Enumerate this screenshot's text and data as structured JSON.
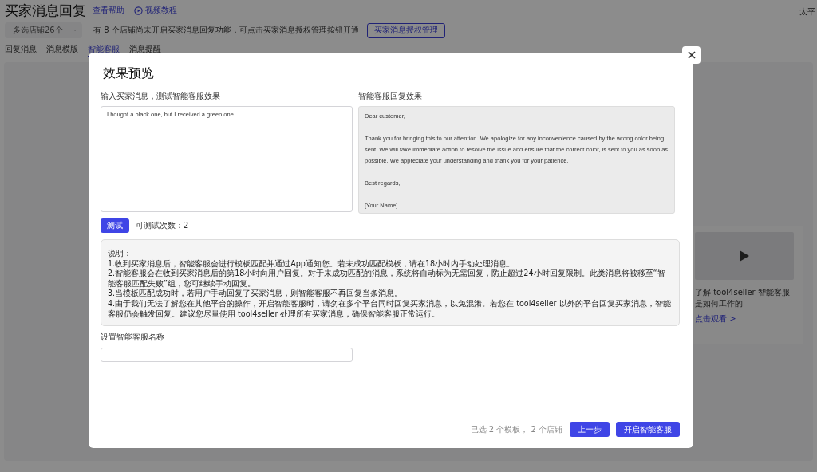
{
  "page": {
    "title": "买家消息回复",
    "help_link": "查看帮助",
    "video_link": "视频教程",
    "top_right": "太平",
    "store_select": {
      "value": "多选店铺26个"
    },
    "notice": "有 8 个店铺尚未开启买家消息回复功能，可点击买家消息授权管理按钮开通",
    "auth_button": "买家消息授权管理",
    "tabs": [
      {
        "label": "回复消息",
        "selected": false
      },
      {
        "label": "消息模版",
        "selected": false
      },
      {
        "label": "智能客服",
        "selected": true
      },
      {
        "label": "消息提醒",
        "selected": false
      }
    ],
    "video_card": {
      "title": "了解 tool4seller 智能客服是如何工作的",
      "link": "点击观看 >"
    }
  },
  "dialog": {
    "title": "效果预览",
    "input_label": "输入买家消息，测试智能客服效果",
    "input_value": "I bought a black one, but I received a green one",
    "reply_label": "智能客服回复效果",
    "reply_paragraphs": [
      "Dear customer,",
      "Thank you for bringing this to our attention. We apologize for any inconvenience caused by the wrong color being sent. We will take immediate action to resolve the issue and ensure that the correct color, is sent to you as soon as possible. We appreciate your understanding and thank you for your patience.",
      "Best regards,",
      "[Your Name]"
    ],
    "test_button": "测试",
    "remaining": "可测试次数：2",
    "notes_title": "说明：",
    "notes": [
      "1.收到买家消息后，智能客服会进行模板匹配并通过App通知您。若未成功匹配模板，请在18小时内手动处理消息。",
      "2.智能客服会在收到买家消息后的第18小时向用户回复。对于未成功匹配的消息，系统将自动标为无需回复，防止超过24小时回复限制。此类消息将被移至“智能客服匹配失败”组，您可继续手动回复。",
      "3.当模板匹配成功时，若用户手动回复了买家消息，则智能客服不再回复当条消息。",
      "4.由于我们无法了解您在其他平台的操作，开启智能客服时，请勿在多个平台同时回复买家消息，以免混淆。若您在 tool4seller 以外的平台回复买家消息，智能客服仍会触发回复。建议您尽量使用 tool4seller 处理所有买家消息，确保智能客服正常运行。"
    ],
    "name_label": "设置智能客服名称",
    "selection_summary": "已选 2 个模板， 2 个店铺",
    "back_button": "上一步",
    "start_button": "开启智能客服"
  }
}
